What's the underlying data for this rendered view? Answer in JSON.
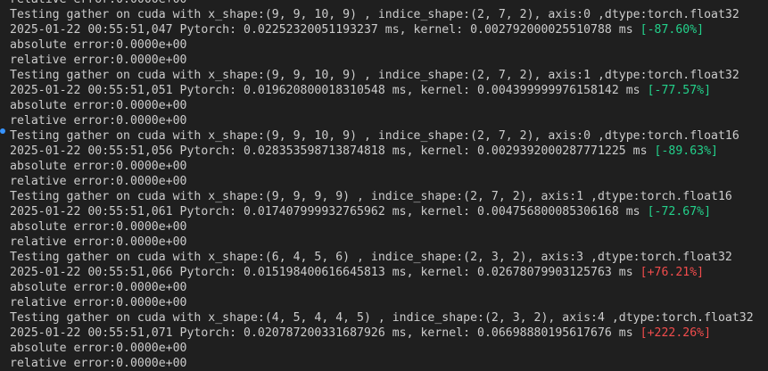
{
  "terminal": {
    "colors": {
      "background": "#1f1f1f",
      "text": "#cccccc",
      "speedup": "#23d18b",
      "slowdown": "#f14c4c",
      "marker": "#3794ff"
    },
    "top_partial": "relative error:0.0000e+00",
    "blocks": [
      {
        "header": "Testing gather on cuda with x_shape:(9, 9, 10, 9) , indice_shape:(2, 7, 2), axis:0 ,dtype:torch.float32",
        "timing": "2025-01-22 00:55:51,047 Pytorch: 0.02252320051193237 ms, kernel: 0.002792000025510788 ms ",
        "percent": "[-87.60%]",
        "abs_err": "absolute error:0.0000e+00",
        "rel_err": "relative error:0.0000e+00"
      },
      {
        "header": "Testing gather on cuda with x_shape:(9, 9, 10, 9) , indice_shape:(2, 7, 2), axis:1 ,dtype:torch.float32",
        "timing": "2025-01-22 00:55:51,051 Pytorch: 0.019620800018310548 ms, kernel: 0.004399999976158142 ms ",
        "percent": "[-77.57%]",
        "abs_err": "absolute error:0.0000e+00",
        "rel_err": "relative error:0.0000e+00"
      },
      {
        "header": "Testing gather on cuda with x_shape:(9, 9, 10, 9) , indice_shape:(2, 7, 2), axis:0 ,dtype:torch.float16",
        "timing": "2025-01-22 00:55:51,056 Pytorch: 0.028353598713874818 ms, kernel: 0.0029392000287771225 ms ",
        "percent": "[-89.63%]",
        "abs_err": "absolute error:0.0000e+00",
        "rel_err": "relative error:0.0000e+00"
      },
      {
        "header": "Testing gather on cuda with x_shape:(9, 9, 9, 9) , indice_shape:(2, 7, 2), axis:1 ,dtype:torch.float16",
        "timing": "2025-01-22 00:55:51,061 Pytorch: 0.017407999932765962 ms, kernel: 0.004756800085306168 ms ",
        "percent": "[-72.67%]",
        "abs_err": "absolute error:0.0000e+00",
        "rel_err": "relative error:0.0000e+00"
      },
      {
        "header": "Testing gather on cuda with x_shape:(6, 4, 5, 6) , indice_shape:(2, 3, 2), axis:3 ,dtype:torch.float32",
        "timing": "2025-01-22 00:55:51,066 Pytorch: 0.015198400616645813 ms, kernel: 0.02678079903125763 ms ",
        "percent": "[+76.21%]",
        "abs_err": "absolute error:0.0000e+00",
        "rel_err": "relative error:0.0000e+00"
      },
      {
        "header": "Testing gather on cuda with x_shape:(4, 5, 4, 4, 5) , indice_shape:(2, 3, 2), axis:4 ,dtype:torch.float32",
        "timing": "2025-01-22 00:55:51,071 Pytorch: 0.020787200331687926 ms, kernel: 0.06698880195617676 ms ",
        "percent": "[+222.26%]",
        "abs_err": "absolute error:0.0000e+00",
        "rel_err": "relative error:0.0000e+00"
      }
    ]
  }
}
